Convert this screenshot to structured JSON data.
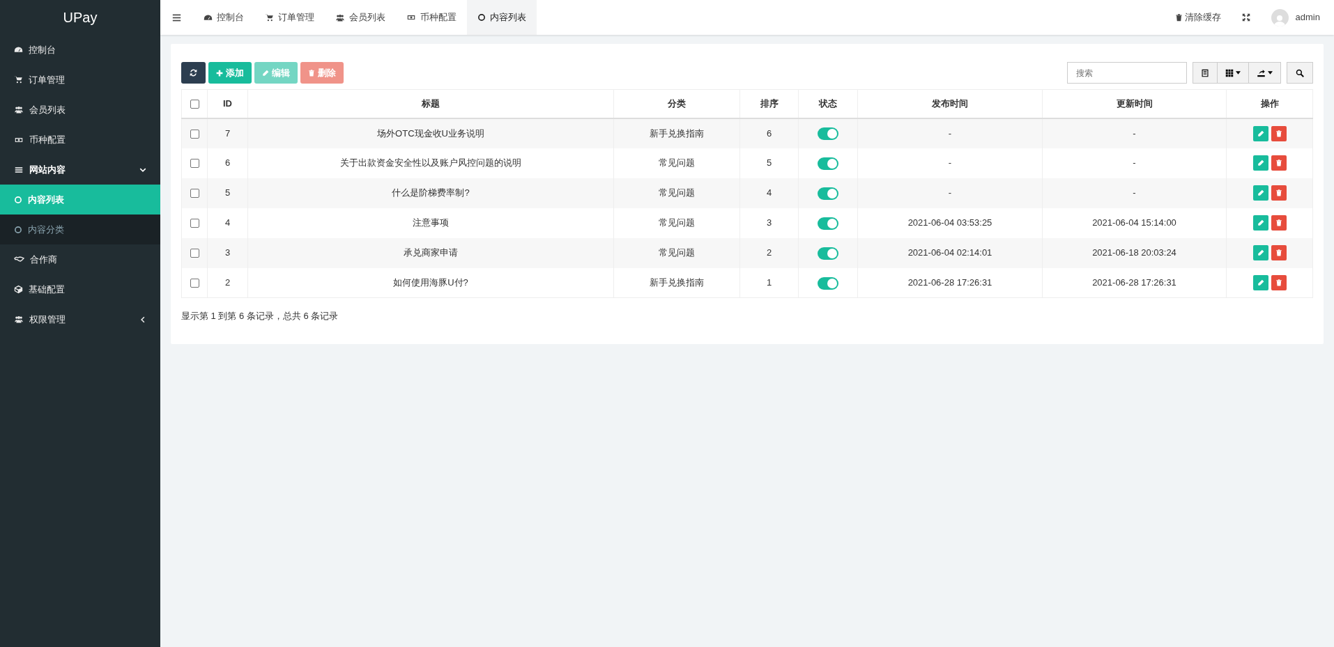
{
  "sidebar": {
    "brand": "UPay",
    "items": [
      {
        "label": "控制台",
        "selected": false
      },
      {
        "label": "订单管理",
        "selected": false
      },
      {
        "label": "会员列表",
        "selected": false
      },
      {
        "label": "币种配置",
        "selected": false
      },
      {
        "label": "网站内容",
        "selected": false,
        "expanded": true,
        "children": [
          {
            "label": "内容列表",
            "selected": true
          },
          {
            "label": "内容分类",
            "selected": false
          }
        ]
      },
      {
        "label": "合作商",
        "selected": false
      },
      {
        "label": "基础配置",
        "selected": false
      },
      {
        "label": "权限管理",
        "selected": false,
        "expanded": false
      }
    ]
  },
  "tabs": [
    {
      "label": "控制台",
      "selected": false
    },
    {
      "label": "订单管理",
      "selected": false
    },
    {
      "label": "会员列表",
      "selected": false
    },
    {
      "label": "币种配置",
      "selected": false
    },
    {
      "label": "内容列表",
      "selected": true
    }
  ],
  "header_right": {
    "clear_cache": "清除缓存",
    "user": "admin"
  },
  "toolbar": {
    "buttons": [
      {
        "kind": "refresh",
        "disabled": false
      },
      {
        "kind": "add",
        "label": "添加",
        "disabled": false
      },
      {
        "kind": "edit",
        "label": "编辑",
        "disabled": true
      },
      {
        "kind": "delete",
        "label": "删除",
        "disabled": true
      }
    ],
    "search": {
      "placeholder": "搜索"
    }
  },
  "table": {
    "select_all_checked": false,
    "columns": [
      "ID",
      "标题",
      "分类",
      "排序",
      "状态",
      "发布时间",
      "更新时间",
      "操作"
    ],
    "rows": [
      {
        "checked": false,
        "id": "7",
        "title": "场外OTC现金收U业务说明",
        "category": "新手兑换指南",
        "sort": "6",
        "on": true,
        "published": "-",
        "updated": "-"
      },
      {
        "checked": false,
        "id": "6",
        "title": "关于出款资金安全性以及账户风控问题的说明",
        "category": "常见问题",
        "sort": "5",
        "on": true,
        "published": "-",
        "updated": "-"
      },
      {
        "checked": false,
        "id": "5",
        "title": "什么是阶梯费率制?",
        "category": "常见问题",
        "sort": "4",
        "on": true,
        "published": "-",
        "updated": "-"
      },
      {
        "checked": false,
        "id": "4",
        "title": "注意事项",
        "category": "常见问题",
        "sort": "3",
        "on": true,
        "published": "2021-06-04 03:53:25",
        "updated": "2021-06-04 15:14:00"
      },
      {
        "checked": false,
        "id": "3",
        "title": "承兑商家申请",
        "category": "常见问题",
        "sort": "2",
        "on": true,
        "published": "2021-06-04 02:14:01",
        "updated": "2021-06-18 20:03:24"
      },
      {
        "checked": false,
        "id": "2",
        "title": "如何使用海豚U付?",
        "category": "新手兑换指南",
        "sort": "1",
        "on": true,
        "published": "2021-06-28 17:26:31",
        "updated": "2021-06-28 17:26:31"
      }
    ]
  },
  "pagination_info": "显示第 1 到第 6 条记录，总共 6 条记录"
}
